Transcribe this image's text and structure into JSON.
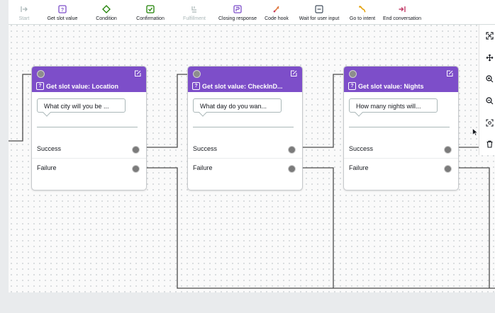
{
  "toolbar": {
    "items": [
      {
        "label": "Start",
        "icon": "start-icon",
        "disabled": true
      },
      {
        "label": "Get slot value",
        "icon": "get-slot-value-icon",
        "disabled": false
      },
      {
        "label": "Condition",
        "icon": "condition-icon",
        "disabled": false
      },
      {
        "label": "Confirmation",
        "icon": "confirmation-icon",
        "disabled": false
      },
      {
        "label": "Fulfillment",
        "icon": "fulfillment-icon",
        "disabled": true
      },
      {
        "label": "Closing response",
        "icon": "closing-response-icon",
        "disabled": false
      },
      {
        "label": "Code hook",
        "icon": "code-hook-icon",
        "disabled": false
      },
      {
        "label": "Wait for user input",
        "icon": "wait-for-user-input-icon",
        "disabled": false
      },
      {
        "label": "Go to intent",
        "icon": "go-to-intent-icon",
        "disabled": false
      },
      {
        "label": "End conversation",
        "icon": "end-conversation-icon",
        "disabled": false
      }
    ]
  },
  "nodes": [
    {
      "title": "Get slot value: Location",
      "prompt": "What city will you be ...",
      "success": "Success",
      "failure": "Failure"
    },
    {
      "title": "Get slot value: CheckInD...",
      "prompt": "What day do you wan...",
      "success": "Success",
      "failure": "Failure"
    },
    {
      "title": "Get slot value: Nights",
      "prompt": "How many nights will...",
      "success": "Success",
      "failure": "Failure"
    }
  ],
  "side_toolbar": [
    "fit-view-icon",
    "move-icon",
    "zoom-in-icon",
    "zoom-out-icon",
    "reset-view-icon",
    "delete-icon"
  ],
  "colors": {
    "node_header": "#7d4ec9",
    "canvas": "#fafafa",
    "connector": "#4a4a4a",
    "port": "#7b7b7b"
  }
}
